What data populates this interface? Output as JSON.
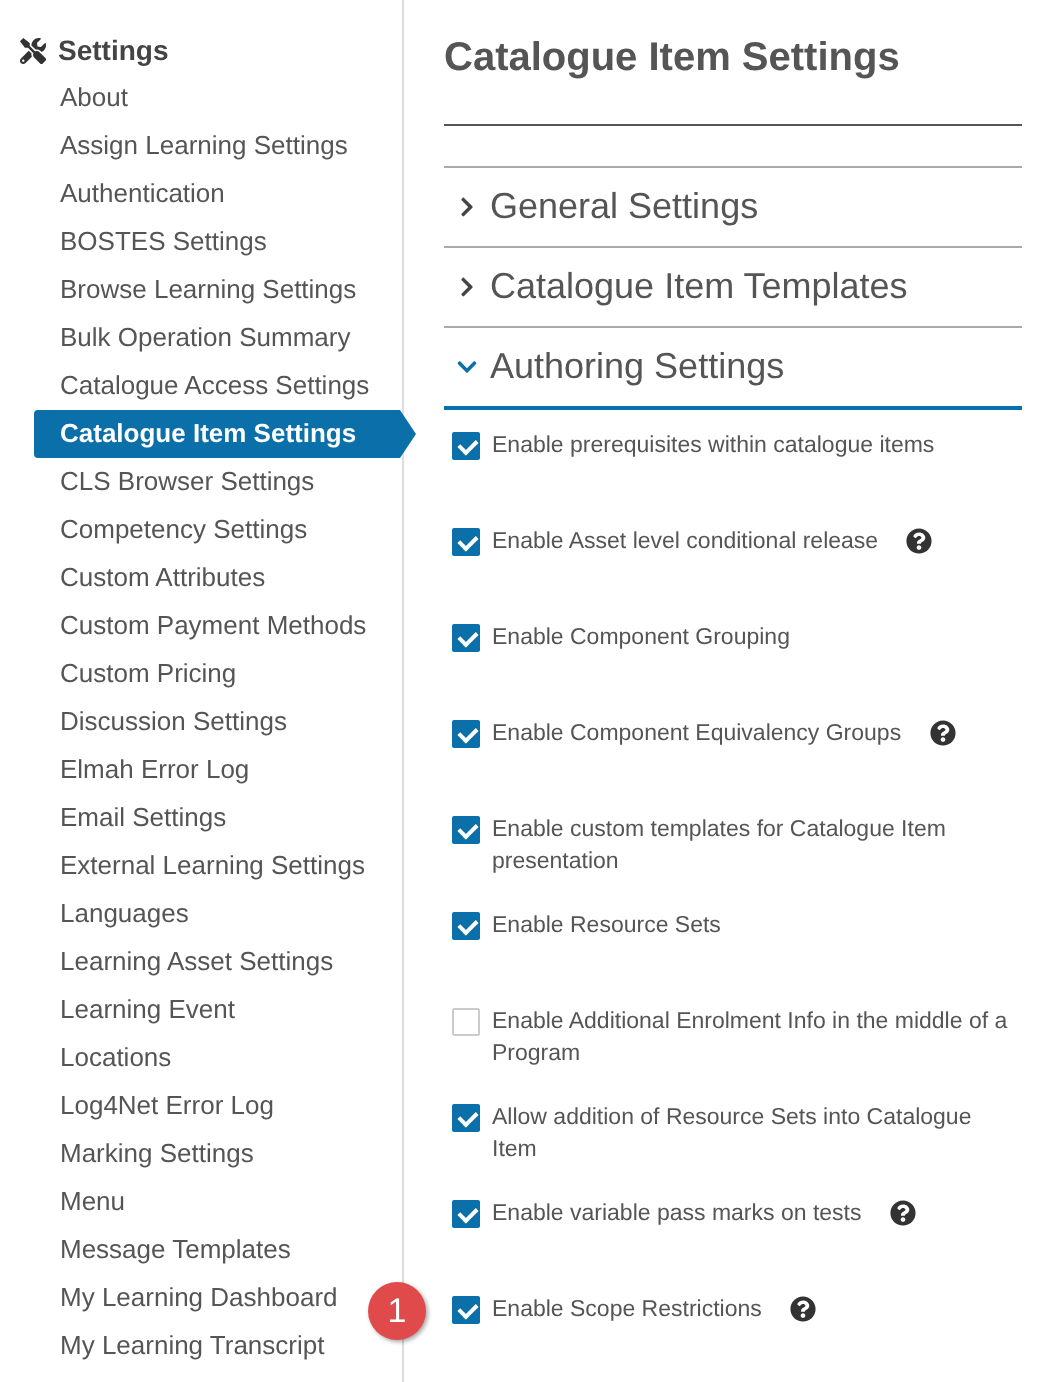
{
  "sidebar": {
    "title": "Settings",
    "items": [
      {
        "label": "About",
        "selected": false
      },
      {
        "label": "Assign Learning Settings",
        "selected": false
      },
      {
        "label": "Authentication",
        "selected": false
      },
      {
        "label": "BOSTES Settings",
        "selected": false
      },
      {
        "label": "Browse Learning Settings",
        "selected": false
      },
      {
        "label": "Bulk Operation Summary",
        "selected": false
      },
      {
        "label": "Catalogue Access Settings",
        "selected": false
      },
      {
        "label": "Catalogue Item Settings",
        "selected": true
      },
      {
        "label": "CLS Browser Settings",
        "selected": false
      },
      {
        "label": "Competency Settings",
        "selected": false
      },
      {
        "label": "Custom Attributes",
        "selected": false
      },
      {
        "label": "Custom Payment Methods",
        "selected": false
      },
      {
        "label": "Custom Pricing",
        "selected": false
      },
      {
        "label": "Discussion Settings",
        "selected": false
      },
      {
        "label": "Elmah Error Log",
        "selected": false
      },
      {
        "label": "Email Settings",
        "selected": false
      },
      {
        "label": "External Learning Settings",
        "selected": false
      },
      {
        "label": "Languages",
        "selected": false
      },
      {
        "label": "Learning Asset Settings",
        "selected": false
      },
      {
        "label": "Learning Event",
        "selected": false
      },
      {
        "label": "Locations",
        "selected": false
      },
      {
        "label": "Log4Net Error Log",
        "selected": false
      },
      {
        "label": "Marking Settings",
        "selected": false
      },
      {
        "label": "Menu",
        "selected": false
      },
      {
        "label": "Message Templates",
        "selected": false
      },
      {
        "label": "My Learning Dashboard",
        "selected": false
      },
      {
        "label": "My Learning Transcript",
        "selected": false
      }
    ]
  },
  "page": {
    "title": "Catalogue Item Settings"
  },
  "sections": [
    {
      "label": "General Settings",
      "expanded": false
    },
    {
      "label": "Catalogue Item Templates",
      "expanded": false
    },
    {
      "label": "Authoring Settings",
      "expanded": true
    }
  ],
  "options": [
    {
      "label": "Enable prerequisites within catalogue items",
      "checked": true,
      "help": false
    },
    {
      "label": "Enable Asset level conditional release",
      "checked": true,
      "help": true
    },
    {
      "label": "Enable Component Grouping",
      "checked": true,
      "help": false
    },
    {
      "label": "Enable Component Equivalency Groups",
      "checked": true,
      "help": true
    },
    {
      "label": "Enable custom templates for Catalogue Item presentation",
      "checked": true,
      "help": false
    },
    {
      "label": "Enable Resource Sets",
      "checked": true,
      "help": false
    },
    {
      "label": "Enable Additional Enrolment Info in the middle of a Program",
      "checked": false,
      "help": false
    },
    {
      "label": "Allow addition of Resource Sets into Catalogue Item",
      "checked": true,
      "help": false
    },
    {
      "label": "Enable variable pass marks on tests",
      "checked": true,
      "help": true
    },
    {
      "label": "Enable Scope Restrictions",
      "checked": true,
      "help": true
    }
  ],
  "callout": {
    "label": "1"
  }
}
